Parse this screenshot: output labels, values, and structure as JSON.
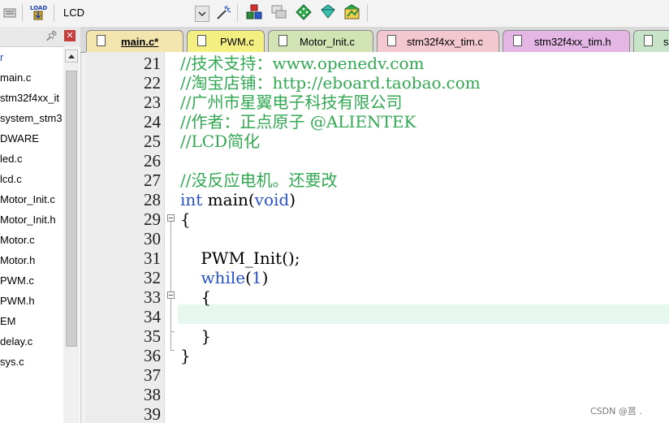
{
  "toolbar": {
    "target_name": "LCD",
    "load_label": "LOAD"
  },
  "sidebar": {
    "items": [
      "r",
      "main.c",
      "stm32f4xx_it",
      "system_stm3",
      "DWARE",
      "led.c",
      "lcd.c",
      "Motor_Init.c",
      "Motor_Init.h",
      "Motor.c",
      "Motor.h",
      "PWM.c",
      "PWM.h",
      "EM",
      "delay.c",
      "sys.c"
    ]
  },
  "tabs": [
    {
      "label": "main.c*",
      "color": "#f4e4ae",
      "active": true
    },
    {
      "label": "PWM.c",
      "color": "#f3ef80",
      "active": false
    },
    {
      "label": "Motor_Init.c",
      "color": "#d3e4b4",
      "active": false
    },
    {
      "label": "stm32f4xx_tim.c",
      "color": "#f4c8d0",
      "active": false
    },
    {
      "label": "stm32f4xx_tim.h",
      "color": "#e4b6e4",
      "active": false
    },
    {
      "label": "s",
      "color": "#c8e4c8",
      "active": false
    }
  ],
  "editor": {
    "lines": [
      {
        "num": "21",
        "text": "//技术支持：www.openedv.com",
        "kind": "comment"
      },
      {
        "num": "22",
        "text": "//淘宝店铺：http://eboard.taobao.com",
        "kind": "comment"
      },
      {
        "num": "23",
        "text": "//广州市星翼电子科技有限公司",
        "kind": "comment"
      },
      {
        "num": "24",
        "text": "//作者：正点原子 @ALIENTEK",
        "kind": "comment"
      },
      {
        "num": "25",
        "text": "//LCD简化",
        "kind": "comment"
      },
      {
        "num": "26",
        "text": "",
        "kind": "plain"
      },
      {
        "num": "27",
        "text": "//没反应电机。还要改",
        "kind": "comment"
      },
      {
        "num": "28",
        "text": "int main(void)",
        "kind": "main"
      },
      {
        "num": "29",
        "text": "{",
        "kind": "plain"
      },
      {
        "num": "30",
        "text": "",
        "kind": "plain"
      },
      {
        "num": "31",
        "text": "    PWM_Init();",
        "kind": "plain"
      },
      {
        "num": "32",
        "text": "    while(1)",
        "kind": "while"
      },
      {
        "num": "33",
        "text": "    {",
        "kind": "plain"
      },
      {
        "num": "34",
        "text": "",
        "kind": "plain"
      },
      {
        "num": "35",
        "text": "    }",
        "kind": "plain"
      },
      {
        "num": "36",
        "text": "}",
        "kind": "plain"
      },
      {
        "num": "37",
        "text": "",
        "kind": "plain"
      },
      {
        "num": "38",
        "text": "",
        "kind": "plain"
      },
      {
        "num": "39",
        "text": "",
        "kind": "plain"
      }
    ],
    "current_line": "34"
  },
  "watermark": "CSDN @莒 ."
}
